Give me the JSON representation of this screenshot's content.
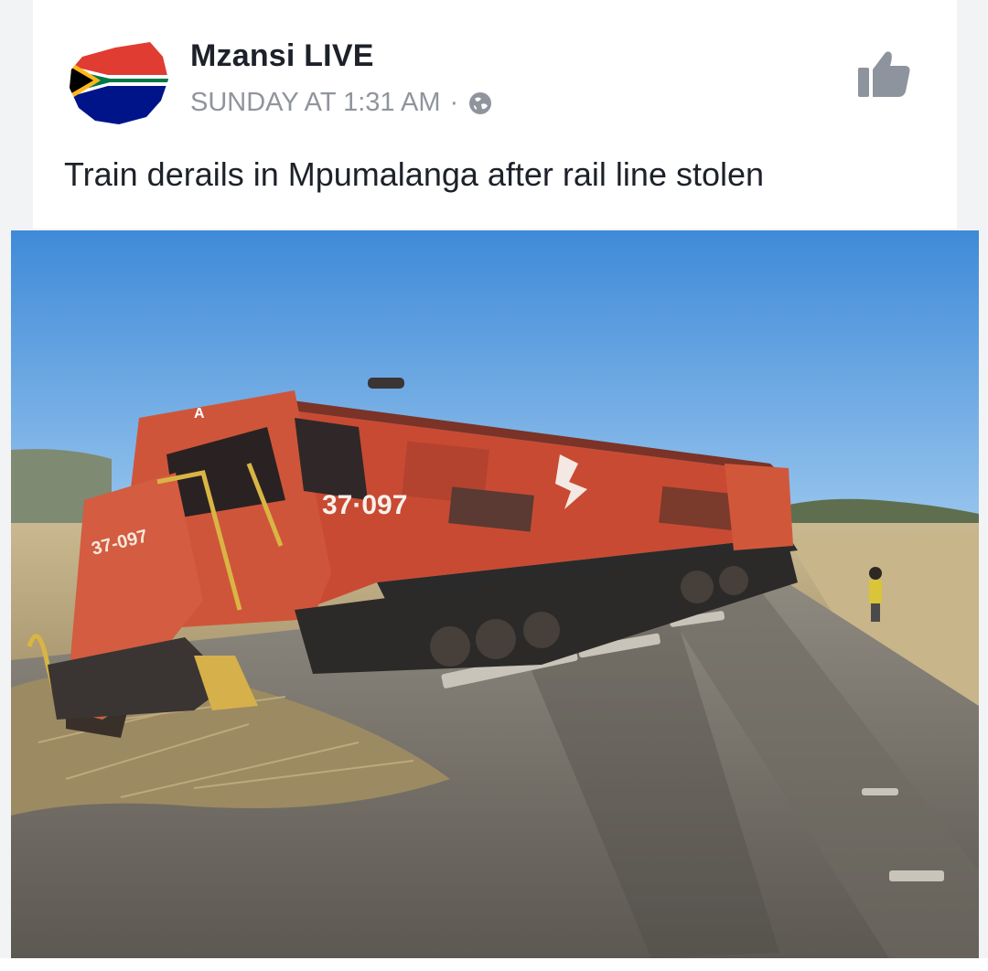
{
  "post": {
    "page_name": "Mzansi LIVE",
    "timestamp": "SUNDAY AT 1:31 AM",
    "separator": "·",
    "privacy_icon": "globe-icon",
    "like_icon": "thumbs-up-icon",
    "avatar": "south-africa-flag-map-logo",
    "headline": "Train derails in Mpumalanga after rail line stolen"
  },
  "photo": {
    "subject": "derailed-locomotive",
    "locomotive_number": "37·097",
    "locomotive_number_nose": "37-097",
    "cab_badge": "A"
  },
  "colors": {
    "name_text": "#1d2129",
    "meta_text": "#90949c",
    "locomotive": "#c94a33",
    "sky": "#4a90d9"
  }
}
